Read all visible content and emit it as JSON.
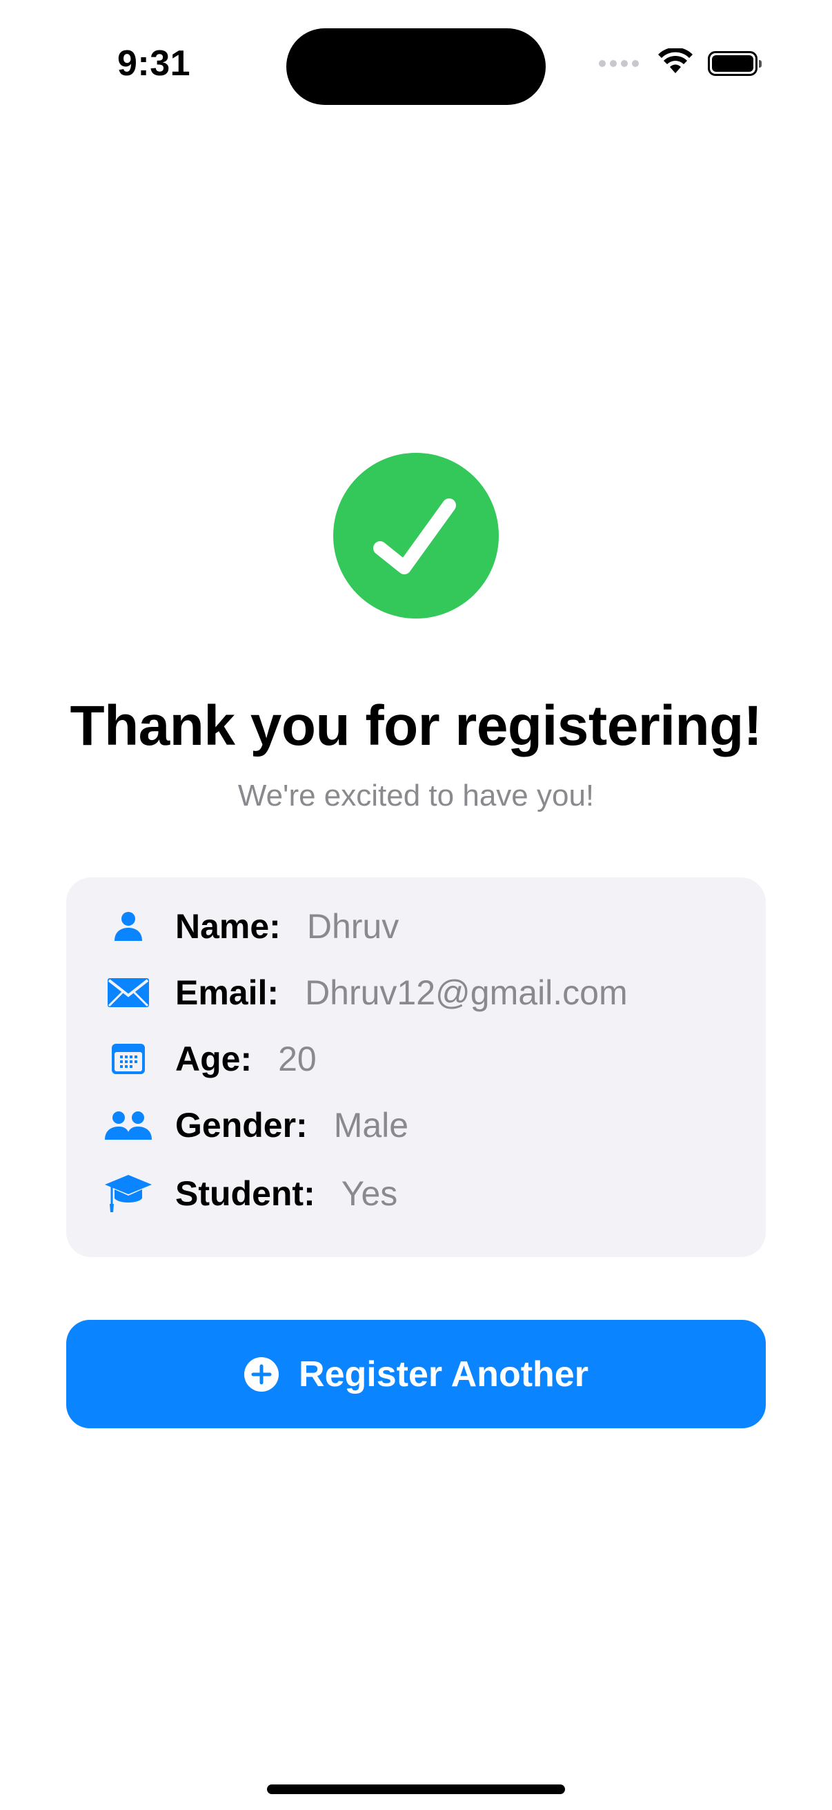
{
  "status_bar": {
    "time": "9:31"
  },
  "confirmation": {
    "icon": "checkmark-icon",
    "title": "Thank you for registering!",
    "subtitle": "We're excited to have you!"
  },
  "details": {
    "rows": [
      {
        "icon": "person-icon",
        "label": "Name:",
        "value": "Dhruv"
      },
      {
        "icon": "envelope-icon",
        "label": "Email:",
        "value": "Dhruv12@gmail.com"
      },
      {
        "icon": "calendar-icon",
        "label": "Age:",
        "value": "20"
      },
      {
        "icon": "people-icon",
        "label": "Gender:",
        "value": "Male"
      },
      {
        "icon": "graduation-cap-icon",
        "label": "Student:",
        "value": "Yes"
      }
    ]
  },
  "actions": {
    "register_another_label": "Register Another",
    "register_another_icon": "plus-circle-icon"
  },
  "colors": {
    "accent": "#0a84ff",
    "success": "#34c759",
    "secondary_text": "#8a8a8e",
    "card_background": "#f2f2f7"
  }
}
